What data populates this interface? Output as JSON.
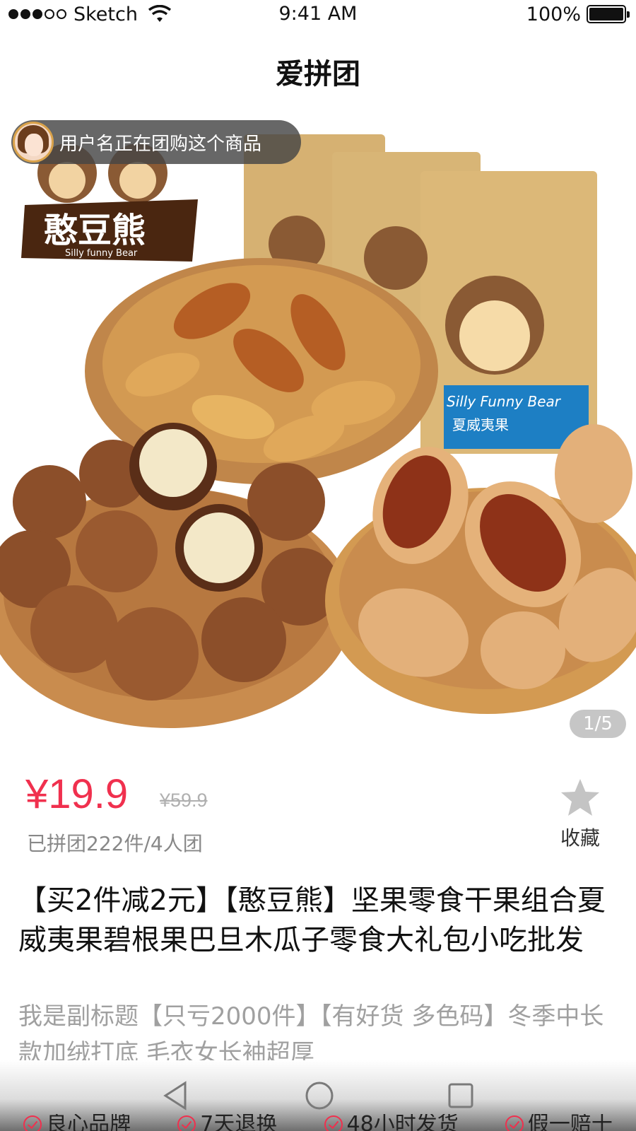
{
  "status_bar": {
    "carrier": "Sketch",
    "time": "9:41 AM",
    "battery": "100%",
    "icons": [
      "signal-dots-icon",
      "wifi-icon",
      "battery-icon"
    ]
  },
  "nav": {
    "title": "爱拼团"
  },
  "gallery": {
    "toast_text": "用户名正在团购这个商品",
    "brand_logo_text": "憨豆熊",
    "brand_logo_subtext": "Silly funny Bear",
    "package_text": "Silly Funny Bear",
    "package_label": "夏威夷果",
    "page_indicator": "1/5"
  },
  "price": {
    "current": "¥19.9",
    "original": "¥59.9",
    "sold_info": "已拼团222件/4人团",
    "favorite_label": "收藏"
  },
  "product": {
    "title": "【买2件减2元】【憨豆熊】坚果零食干果组合夏威夷果碧根果巴旦木瓜子零食大礼包小吃批发",
    "subtitle": "我是副标题【只亏2000件】【有好货 多色码】冬季中长款加绒打底 毛衣女长袖超厚"
  },
  "guarantees": [
    "良心品牌",
    "7天退换",
    "48小时发货",
    "假一赔十"
  ],
  "colors": {
    "accent": "#f0304e",
    "muted": "#a0a0a0"
  }
}
